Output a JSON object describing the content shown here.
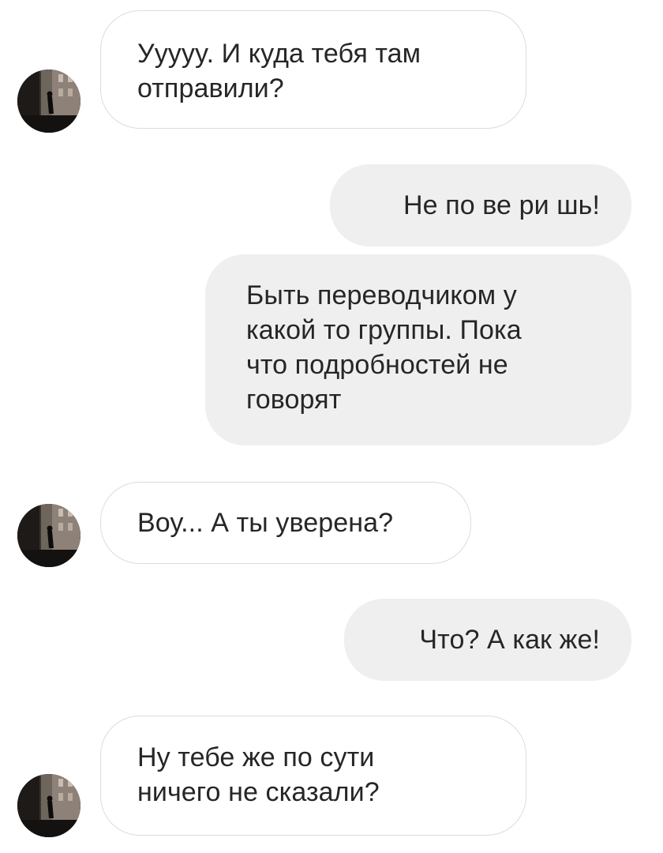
{
  "messages": [
    {
      "side": "incoming",
      "lines": [
        "Уyyyy. И куда тебя там",
        "отправили?"
      ]
    },
    {
      "side": "outgoing",
      "lines": [
        "Не по ве ри шь!"
      ]
    },
    {
      "side": "outgoing",
      "lines": [
        "Быть переводчиком у",
        "какой то группы. Пока",
        "что подробностей не",
        "говорят"
      ]
    },
    {
      "side": "incoming",
      "lines": [
        "Воу... А ты уверена?"
      ]
    },
    {
      "side": "outgoing",
      "lines": [
        "Что? А как же!"
      ]
    },
    {
      "side": "incoming",
      "lines": [
        "Ну тебе же по сути",
        "ничего не сказали?"
      ]
    }
  ],
  "colors": {
    "incoming_bg": "#ffffff",
    "incoming_border": "#dcdcdc",
    "outgoing_bg": "#efefef",
    "text": "#262626"
  },
  "icons": {
    "avatar": "avatar-photo"
  }
}
